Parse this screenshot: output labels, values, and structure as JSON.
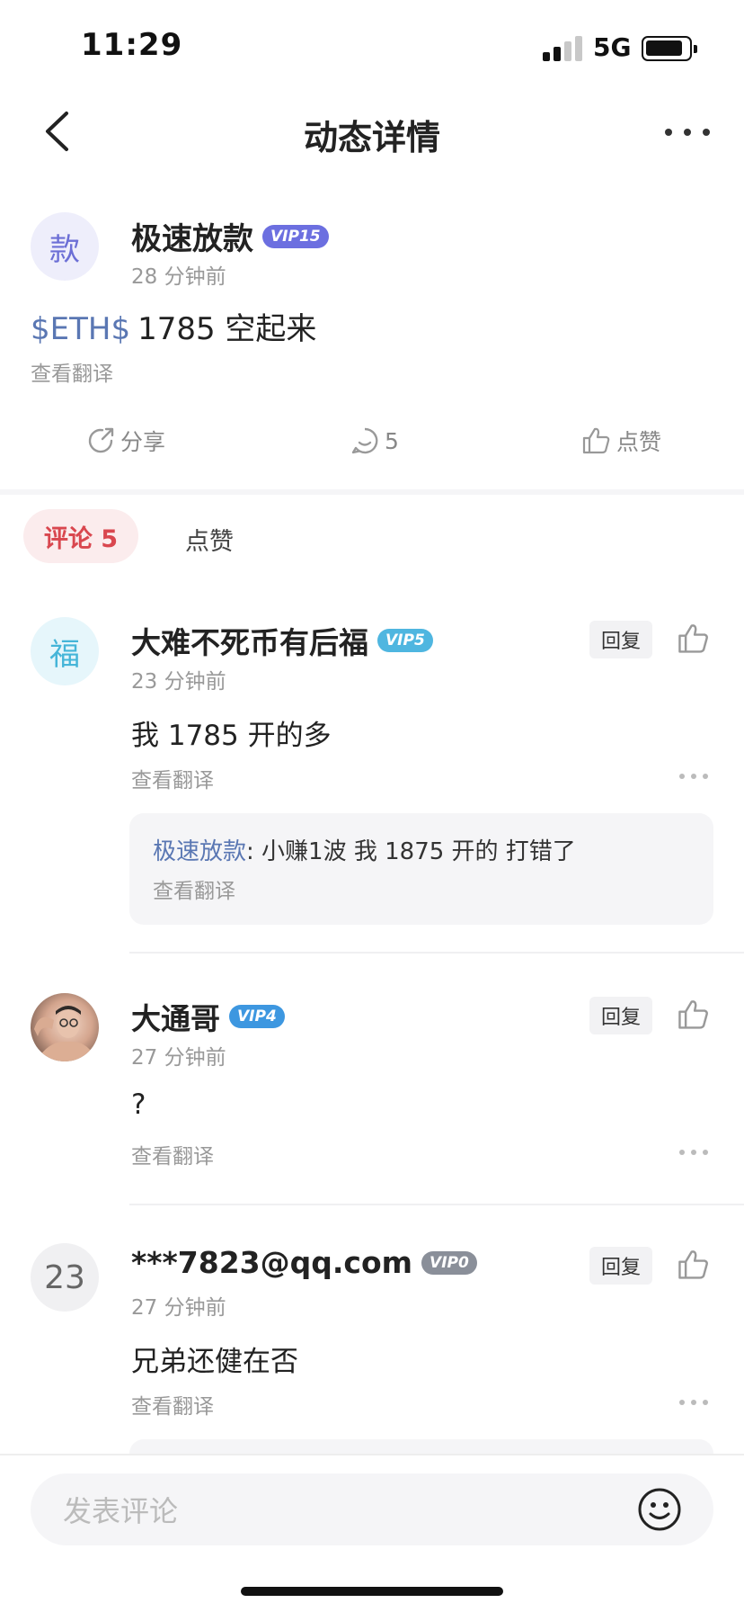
{
  "status_bar": {
    "time": "11:29",
    "network": "5G"
  },
  "nav": {
    "title": "动态详情"
  },
  "post": {
    "avatar_char": "款",
    "username": "极速放款",
    "vip": "VIP15",
    "time": "28 分钟前",
    "tag": "$ETH$",
    "content": "1785 空起来",
    "translate": "查看翻译",
    "actions": {
      "share": "分享",
      "comment_count": "5",
      "like": "点赞"
    }
  },
  "tabs": {
    "comments": "评论 5",
    "likes": "点赞"
  },
  "comments": [
    {
      "avatar_char": "福",
      "username": "大难不死币有后福",
      "vip": "VIP5",
      "time": "23 分钟前",
      "text": "我 1785 开的多",
      "translate": "查看翻译",
      "reply_label": "回复",
      "sub_reply": {
        "author": "极速放款",
        "text": ": 小赚1波 我 1875 开的 打错了",
        "translate": "查看翻译"
      }
    },
    {
      "avatar_char": "",
      "username": "大通哥",
      "vip": "VIP4",
      "time": "27 分钟前",
      "text": "?",
      "translate": "查看翻译",
      "reply_label": "回复"
    },
    {
      "avatar_char": "23",
      "username": "***7823@qq.com",
      "vip": "VIP0",
      "time": "27 分钟前",
      "text": "兄弟还健在否",
      "translate": "查看翻译",
      "reply_label": "回复"
    }
  ],
  "bottom": {
    "placeholder": "发表评论"
  },
  "colors": {
    "accent_red": "#d9474f",
    "link_blue": "#5a77b3",
    "vip15": "#6c6fe0",
    "vip5": "#4fb6e0",
    "vip4": "#3d97e0",
    "vip0": "#8a8f99"
  }
}
